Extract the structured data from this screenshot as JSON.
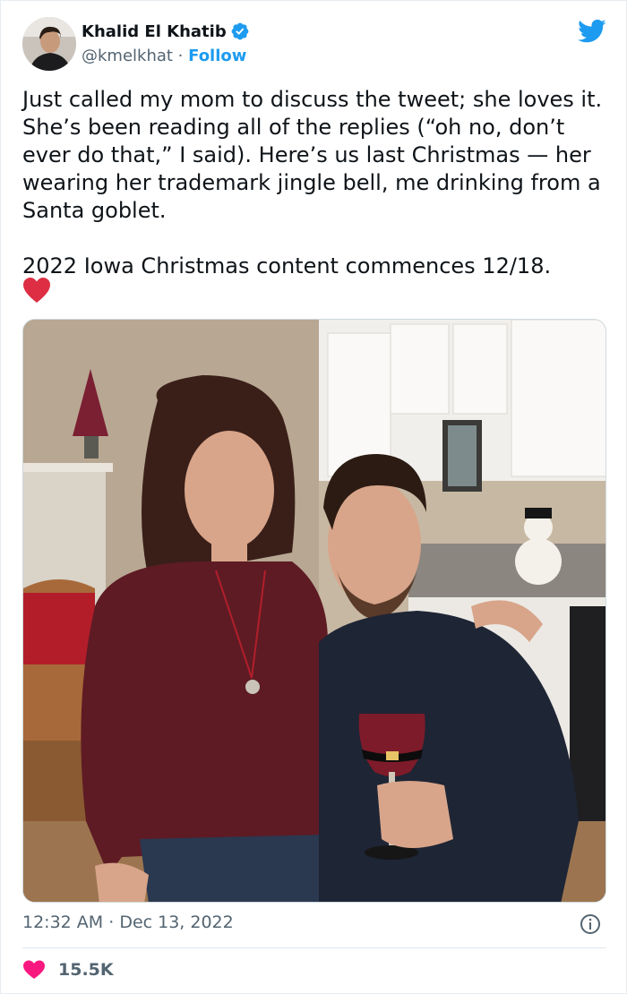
{
  "author": {
    "name": "Khalid El Khatib",
    "handle": "@kmelkhat",
    "separator": " · ",
    "follow_label": "Follow",
    "verified": true
  },
  "tweet": {
    "text": "Just called my mom to discuss the tweet; she loves it. She’s been reading all of the replies (“oh no, don’t ever do that,” I said). Here’s us last Christmas — her wearing her trademark jingle bell, me drinking from a Santa goblet.\n\n2022 Iowa Christmas content commences 12/18.",
    "emoji": "red-heart"
  },
  "meta": {
    "time": "12:32 AM",
    "date": "Dec 13, 2022",
    "separator": " · "
  },
  "stats": {
    "likes": "15.5K"
  },
  "colors": {
    "accent": "#1d9bf0",
    "like": "#f91880",
    "muted": "#536471"
  }
}
